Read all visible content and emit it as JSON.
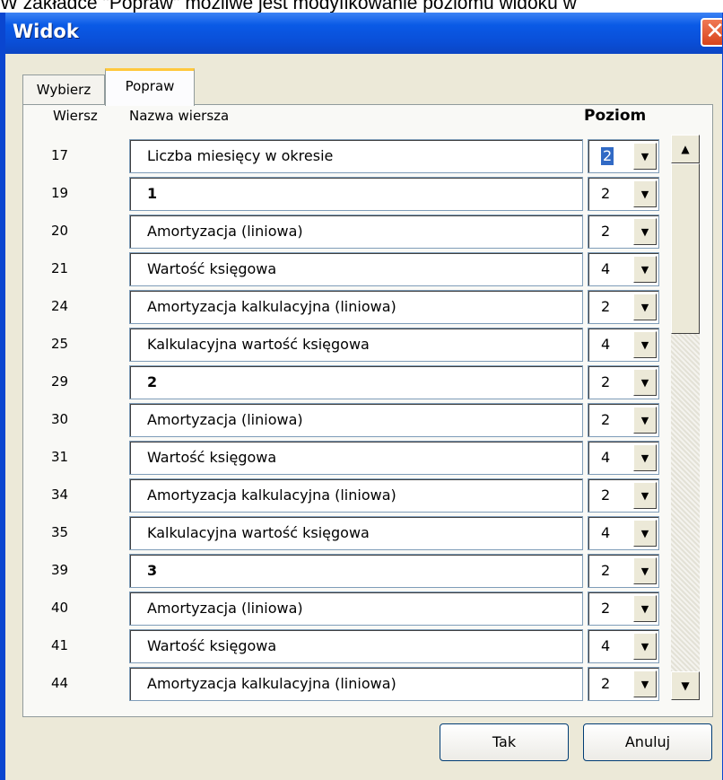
{
  "caption": "W zakładce \"Popraw\" możliwe jest modyfikowanie poziomu widoku w",
  "window": {
    "title": "Widok",
    "close_glyph": "✕"
  },
  "tabs": [
    {
      "label": "Wybierz"
    },
    {
      "label": "Popraw",
      "active": true
    }
  ],
  "headers": {
    "row": "Wiersz",
    "name": "Nazwa wiersza",
    "level": "Poziom"
  },
  "rows": [
    {
      "num": "17",
      "name": "Liczba miesięcy w okresie",
      "level": "2",
      "bold": false,
      "selected": true
    },
    {
      "num": "19",
      "name": "1",
      "level": "2",
      "bold": true
    },
    {
      "num": "20",
      "name": "Amortyzacja (liniowa)",
      "level": "2",
      "bold": false
    },
    {
      "num": "21",
      "name": "Wartość księgowa",
      "level": "4",
      "bold": false
    },
    {
      "num": "24",
      "name": "Amortyzacja kalkulacyjna (liniowa)",
      "level": "2",
      "bold": false
    },
    {
      "num": "25",
      "name": "Kalkulacyjna wartość księgowa",
      "level": "4",
      "bold": false
    },
    {
      "num": "29",
      "name": "2",
      "level": "2",
      "bold": true
    },
    {
      "num": "30",
      "name": "Amortyzacja (liniowa)",
      "level": "2",
      "bold": false
    },
    {
      "num": "31",
      "name": "Wartość księgowa",
      "level": "4",
      "bold": false
    },
    {
      "num": "34",
      "name": "Amortyzacja kalkulacyjna (liniowa)",
      "level": "2",
      "bold": false
    },
    {
      "num": "35",
      "name": "Kalkulacyjna wartość księgowa",
      "level": "4",
      "bold": false
    },
    {
      "num": "39",
      "name": "3",
      "level": "2",
      "bold": true
    },
    {
      "num": "40",
      "name": "Amortyzacja (liniowa)",
      "level": "2",
      "bold": false
    },
    {
      "num": "41",
      "name": "Wartość księgowa",
      "level": "4",
      "bold": false
    },
    {
      "num": "44",
      "name": "Amortyzacja kalkulacyjna (liniowa)",
      "level": "2",
      "bold": false
    }
  ],
  "buttons": {
    "ok": "Tak",
    "cancel": "Anuluj"
  },
  "icons": {
    "dropdown": "chevron-down-icon",
    "scroll_up": "arrow-up-icon",
    "scroll_down": "arrow-down-icon",
    "close": "close-icon"
  },
  "colors": {
    "titlebar": "#0a5ae6",
    "close": "#d8431b",
    "selection": "#316ac5",
    "active_tab_accent": "#ffc83c"
  }
}
